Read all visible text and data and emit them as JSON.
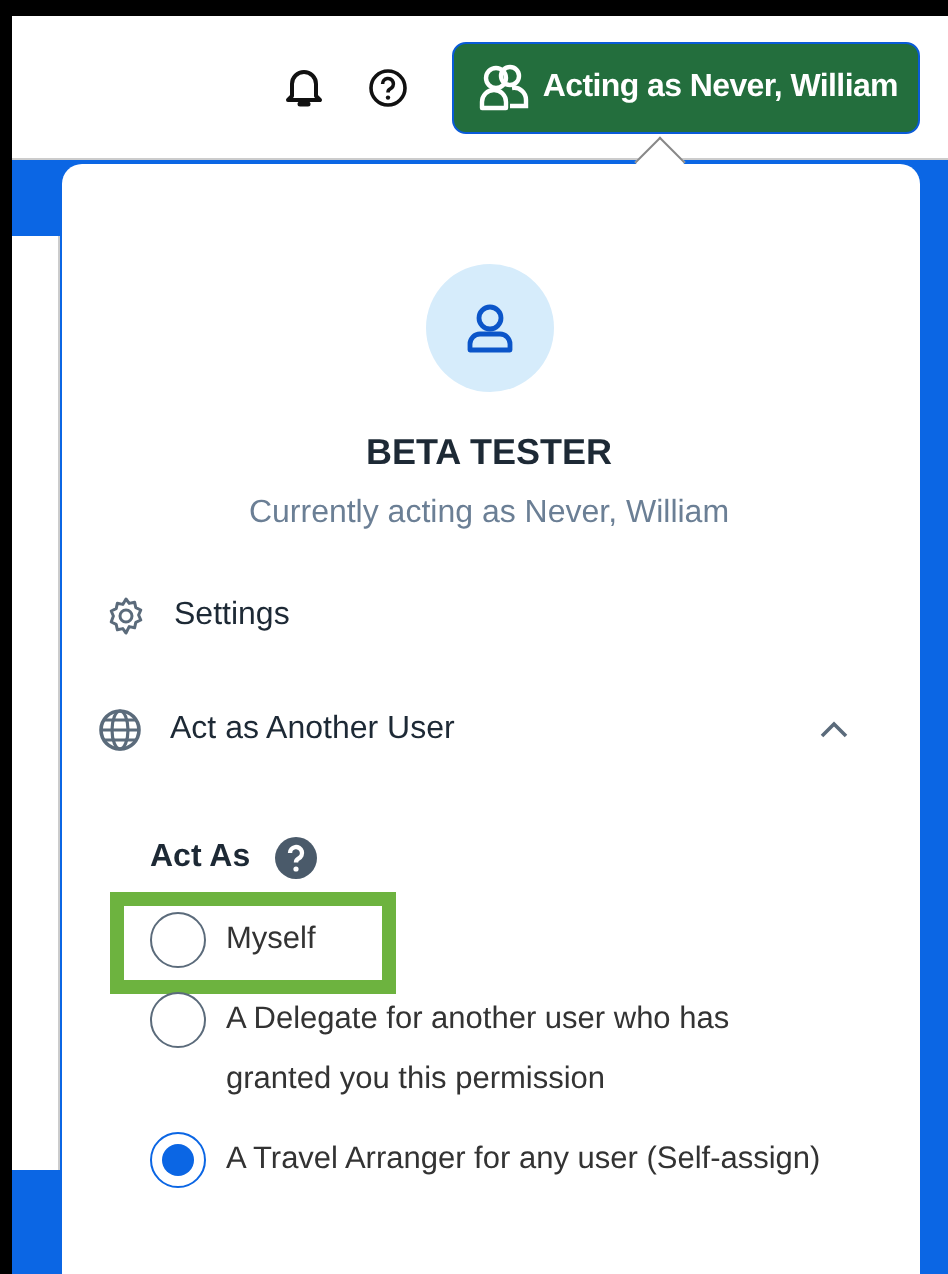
{
  "header": {
    "acting_button": "Acting as Never, William"
  },
  "profile": {
    "name": "BETA TESTER",
    "subtitle": "Currently acting as Never, William"
  },
  "menu": [
    {
      "kind": "settings",
      "label": "Settings"
    },
    {
      "kind": "act_as",
      "label": "Act as Another User",
      "expanded": true
    }
  ],
  "act_as": {
    "label": "Act As",
    "options": [
      {
        "label": "Myself",
        "selected": false,
        "highlighted": true
      },
      {
        "label": "A Delegate for another user who has granted you this permission",
        "selected": false,
        "highlighted": false
      },
      {
        "label": "A Travel Arranger for any user (Self-assign)",
        "selected": true,
        "highlighted": false
      }
    ]
  }
}
